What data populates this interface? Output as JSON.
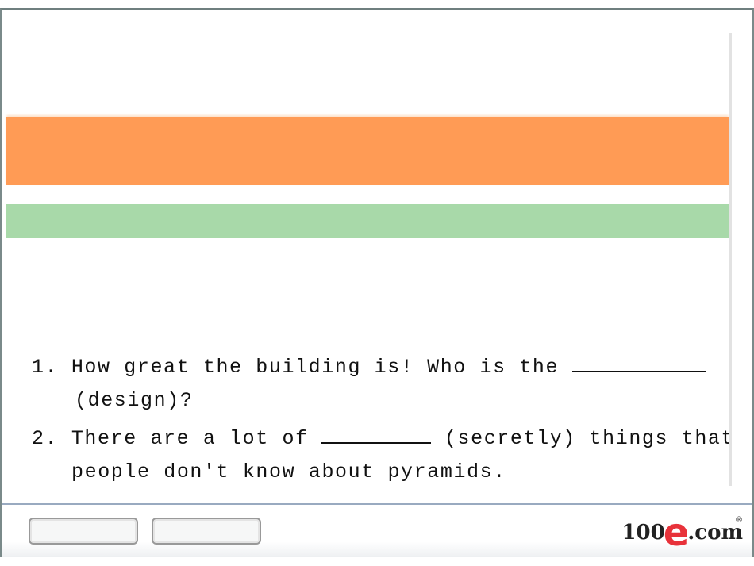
{
  "questions": [
    {
      "number": "1.",
      "line1": "How great the building is! Who is the ",
      "line2": "(design)?"
    },
    {
      "number": "2.",
      "line1": "There are a lot of ",
      "line1b": " (secretly) things that",
      "line2": "people don't know about pyramids."
    }
  ],
  "colors": {
    "orange_band": "#ff9b55",
    "green_band": "#a8d9a9",
    "logo_red": "#e8323a"
  },
  "logo": {
    "text_left": "100",
    "text_e": "e",
    "text_right": ".com",
    "reg": "®"
  }
}
